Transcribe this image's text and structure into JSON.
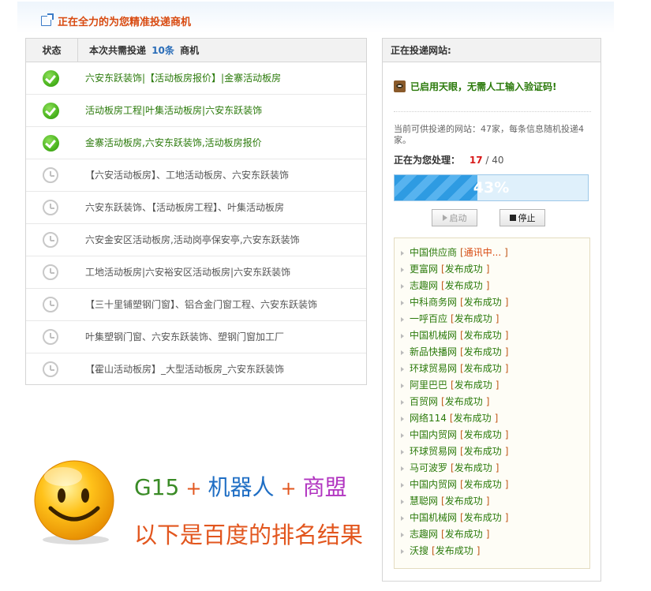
{
  "header": {
    "title": "正在全力的为您精准投递商机"
  },
  "left": {
    "col_status": "状态",
    "col_items_prefix": "本次共需投递",
    "col_items_count": "10条",
    "col_items_suffix": "商机",
    "rows": [
      {
        "status": "done",
        "text": "六安东跃装饰|【活动板房报价】|金寨活动板房"
      },
      {
        "status": "done",
        "text": "活动板房工程|叶集活动板房|六安东跃装饰"
      },
      {
        "status": "done",
        "text": "金寨活动板房,六安东跃装饰,活动板房报价"
      },
      {
        "status": "wait",
        "text": "【六安活动板房】、工地活动板房、六安东跃装饰"
      },
      {
        "status": "wait",
        "text": "六安东跃装饰、【活动板房工程】、叶集活动板房"
      },
      {
        "status": "wait",
        "text": "六安金安区活动板房,活动岗亭保安亭,六安东跃装饰"
      },
      {
        "status": "wait",
        "text": "工地活动板房|六安裕安区活动板房|六安东跃装饰"
      },
      {
        "status": "wait",
        "text": "【三十里铺塑钢门窗】、铝合金门窗工程、六安东跃装饰"
      },
      {
        "status": "wait",
        "text": "叶集塑钢门窗、六安东跃装饰、塑钢门窗加工厂"
      },
      {
        "status": "wait",
        "text": "【霍山活动板房】_大型活动板房_六安东跃装饰"
      }
    ]
  },
  "right": {
    "title": "正在投递网站:",
    "eye_text": "已启用天眼，无需人工输入验证码!",
    "available": "当前可供投递的网站：47家，每条信息随机投递4家。",
    "processing_label": "正在为您处理：",
    "processing_current": "17",
    "processing_sep": "/",
    "processing_total": "40",
    "progress_percent": 43,
    "progress_text": "43%",
    "start_label": "启动",
    "stop_label": "停止",
    "sites": [
      {
        "name": "中国供应商",
        "status": "通讯中...",
        "contact": true
      },
      {
        "name": "更富网",
        "status": "发布成功"
      },
      {
        "name": "志趣网",
        "status": "发布成功"
      },
      {
        "name": "中科商务网",
        "status": "发布成功"
      },
      {
        "name": "一呼百应",
        "status": "发布成功"
      },
      {
        "name": "中国机械网",
        "status": "发布成功"
      },
      {
        "name": "新品快播网",
        "status": "发布成功"
      },
      {
        "name": "环球贸易网",
        "status": "发布成功"
      },
      {
        "name": "阿里巴巴",
        "status": "发布成功"
      },
      {
        "name": "百贸网",
        "status": "发布成功"
      },
      {
        "name": "网络114",
        "status": "发布成功"
      },
      {
        "name": "中国内贸网",
        "status": "发布成功"
      },
      {
        "name": "环球贸易网",
        "status": "发布成功"
      },
      {
        "name": "马可波罗",
        "status": "发布成功"
      },
      {
        "name": "中国内贸网",
        "status": "发布成功"
      },
      {
        "name": "慧聪网",
        "status": "发布成功"
      },
      {
        "name": "中国机械网",
        "status": "发布成功"
      },
      {
        "name": "志趣网",
        "status": "发布成功"
      },
      {
        "name": "沃搜",
        "status": "发布成功"
      }
    ]
  },
  "promo": {
    "g15": "G15",
    "plus": "+",
    "robot": "机器人",
    "alliance": "商盟",
    "rank": "以下是百度的排名结果"
  },
  "icons": {
    "header": "external-link-icon",
    "done": "check-circle-icon",
    "wait": "clock-icon",
    "eye": "eye-icon",
    "smiley": "smiley-face-icon"
  },
  "colors": {
    "accent_orange": "#d84a10",
    "success_green": "#2b7a0b",
    "progress_blue": "#2e9be2"
  }
}
